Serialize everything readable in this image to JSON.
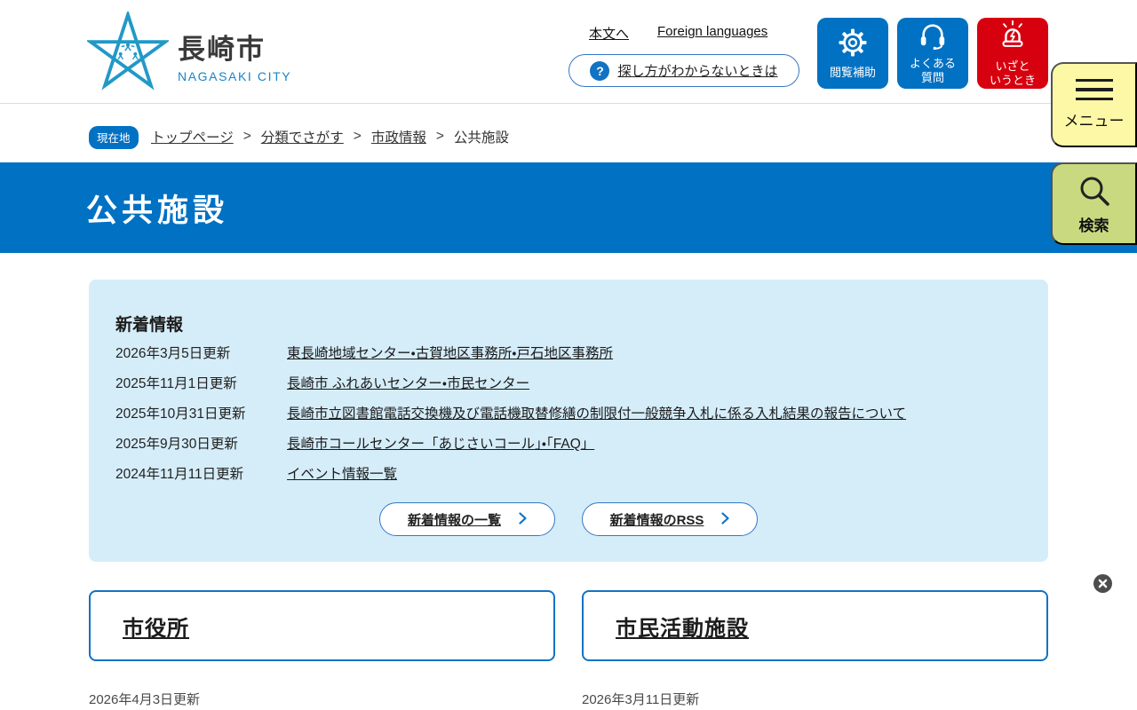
{
  "colors": {
    "primary_blue": "#0171c3",
    "emergency_red": "#d7000f",
    "menu_yellow": "#fdf8a5",
    "search_green": "#c9d97f",
    "news_panel_blue": "#d5edf9",
    "logo_teal": "#2199c7"
  },
  "logo": {
    "name": "長崎市",
    "subname": "NAGASAKI CITY"
  },
  "header": {
    "skip_link": "本文へ",
    "foreign_languages_link": "Foreign languages",
    "help_icon_glyph": "?",
    "help_button_label": "探し方がわからないときは",
    "quick_buttons": [
      {
        "label": "閲覧補助",
        "icon": "gear-icon"
      },
      {
        "label": "よくある\n質問",
        "icon": "headset-icon"
      },
      {
        "label": "いざと\nいうとき",
        "icon": "siren-icon"
      }
    ],
    "menu_tab_label": "メニュー",
    "search_tab_label": "検索"
  },
  "breadcrumb": {
    "current_badge": "現在地",
    "separator": ">",
    "items": [
      {
        "label": "トップページ"
      },
      {
        "label": "分類でさがす"
      },
      {
        "label": "市政情報"
      },
      {
        "label": "公共施設"
      }
    ]
  },
  "page_title": "公共施設",
  "news": {
    "heading": "新着情報",
    "items": [
      {
        "date": "2026年3月5日更新",
        "title": "東長崎地域センター・古賀地区事務所・戸石地区事務所"
      },
      {
        "date": "2025年11月1日更新",
        "title": "長崎市 ふれあいセンター・市民センター"
      },
      {
        "date": "2025年10月31日更新",
        "title": "長崎市立図書館電話交換機及び電話機取替修繕の制限付一般競争入札に係る入札結果の報告について"
      },
      {
        "date": "2025年9月30日更新",
        "title": "長崎市コールセンター「あじさいコール」・「FAQ」"
      },
      {
        "date": "2024年11月11日更新",
        "title": "イベント情報一覧"
      }
    ],
    "list_button_label": "新着情報の一覧",
    "rss_button_label": "新着情報のRSS"
  },
  "categories": [
    {
      "title": "市役所",
      "updated": "2026年4月3日更新"
    },
    {
      "title": "市民活動施設",
      "updated": "2026年3月11日更新"
    }
  ]
}
